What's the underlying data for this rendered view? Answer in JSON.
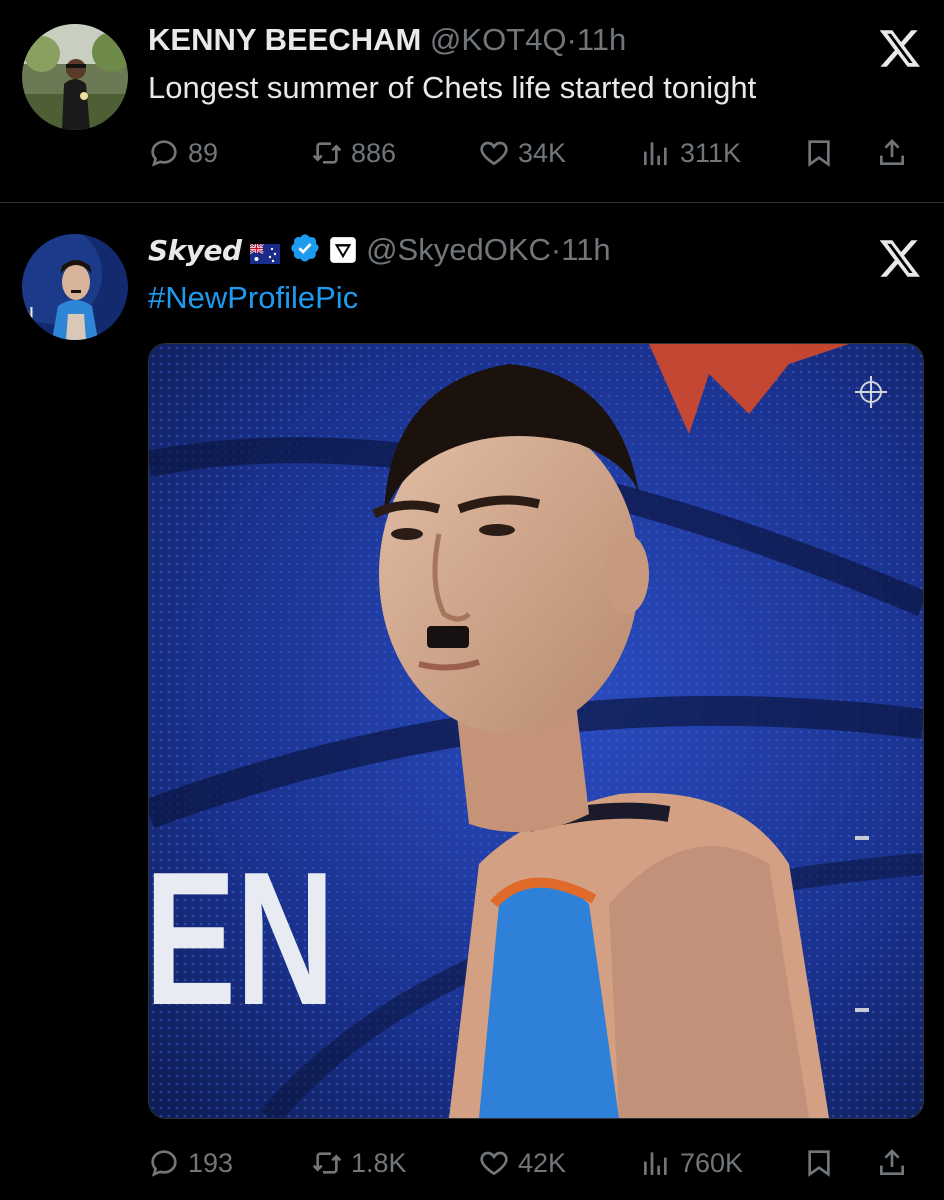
{
  "tweets": [
    {
      "author_name": "KENNY BEECHAM",
      "handle": "@KOT4Q",
      "separator": "·",
      "time": "11h",
      "text": "Longest summer of Chets life started tonight",
      "stats": {
        "replies": "89",
        "reposts": "886",
        "likes": "34K",
        "views": "311K"
      }
    },
    {
      "author_name": "Skyed",
      "handle": "@SkyedOKC",
      "separator": "·",
      "time": "11h",
      "text": "#NewProfilePic",
      "media_text": "EN",
      "stats": {
        "replies": "193",
        "reposts": "1.8K",
        "likes": "42K",
        "views": "760K"
      }
    }
  ],
  "colors": {
    "background": "#000000",
    "text": "#e7e9ea",
    "muted": "#71767b",
    "link": "#1d9bf0",
    "verified": "#1d9bf0"
  },
  "icons": [
    "reply-icon",
    "repost-icon",
    "like-icon",
    "views-icon",
    "bookmark-icon",
    "share-icon",
    "x-logo-icon",
    "verified-badge-icon",
    "australia-flag-icon",
    "affiliate-badge-icon"
  ]
}
